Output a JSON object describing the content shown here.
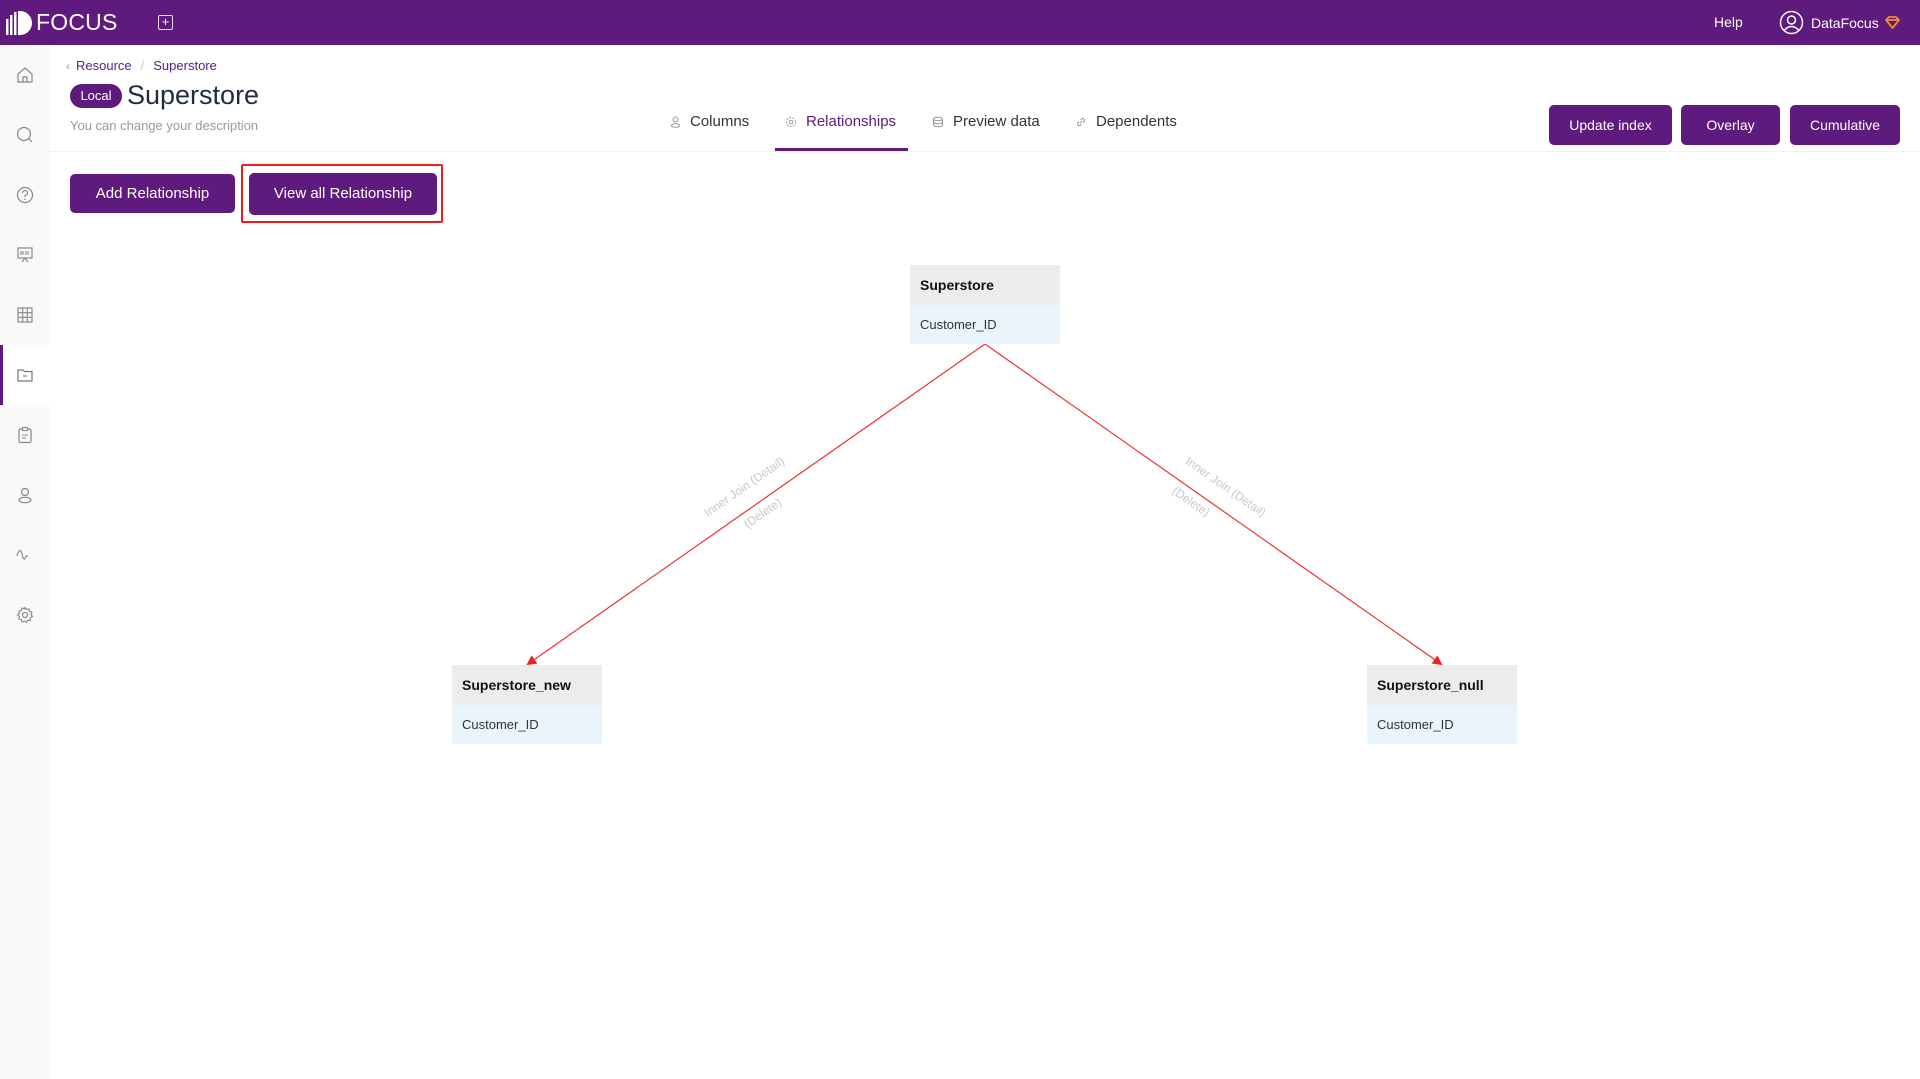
{
  "topbar": {
    "brand": "FOCUS",
    "new_icon": "plus-square-icon",
    "help_label": "Help",
    "user_name": "DataFocus",
    "user_icon": "user-circle-icon",
    "gem_icon": "diamond-icon"
  },
  "sidebar": {
    "items": [
      {
        "icon": "home-icon",
        "active": false
      },
      {
        "icon": "search-icon",
        "active": false
      },
      {
        "icon": "help-circle-icon",
        "active": false
      },
      {
        "icon": "presentation-icon",
        "active": false
      },
      {
        "icon": "table-grid-icon",
        "active": false
      },
      {
        "icon": "folder-icon",
        "active": true
      },
      {
        "icon": "clipboard-icon",
        "active": false
      },
      {
        "icon": "user-icon",
        "active": false
      },
      {
        "icon": "pulse-icon",
        "active": false
      },
      {
        "icon": "gear-icon",
        "active": false
      }
    ]
  },
  "breadcrumb": {
    "items": [
      "Resource",
      "Superstore"
    ],
    "separator": "/"
  },
  "page": {
    "badge": "Local",
    "title": "Superstore",
    "description": "You can change your description"
  },
  "tabs": [
    {
      "label": "Columns",
      "icon": "user-icon",
      "active": false
    },
    {
      "label": "Relationships",
      "icon": "gear-icon",
      "active": true
    },
    {
      "label": "Preview data",
      "icon": "database-icon",
      "active": false
    },
    {
      "label": "Dependents",
      "icon": "link-icon",
      "active": false
    }
  ],
  "header_actions": {
    "update_index": "Update index",
    "overlay": "Overlay",
    "cumulative": "Cumulative"
  },
  "toolbar": {
    "add_relationship": "Add Relationship",
    "view_all_relationship": "View all Relationship"
  },
  "diagram": {
    "nodes": [
      {
        "name": "Superstore",
        "columns": [
          "Customer_ID"
        ]
      },
      {
        "name": "Superstore_new",
        "columns": [
          "Customer_ID"
        ]
      },
      {
        "name": "Superstore_null",
        "columns": [
          "Customer_ID"
        ]
      }
    ],
    "edges": [
      {
        "from": "Superstore",
        "to": "Superstore_new",
        "label": "Inner Join (Detail)",
        "action": "(Delete)"
      },
      {
        "from": "Superstore",
        "to": "Superstore_null",
        "label": "Inner Join (Detail)",
        "action": "(Delete)"
      }
    ],
    "edge_color": "#ee3333"
  },
  "colors": {
    "brand": "#5e1a7c",
    "highlight": "#ee1c1c"
  }
}
